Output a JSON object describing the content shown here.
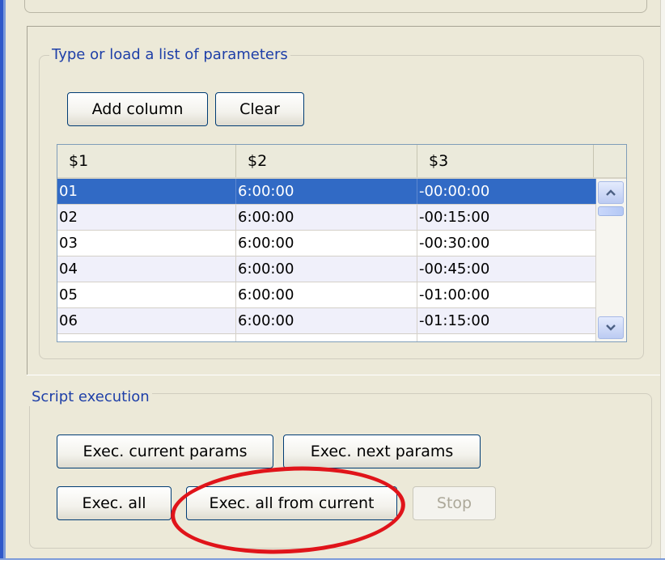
{
  "params_group": {
    "legend": "Type or load a list of parameters",
    "add_column_label": "Add column",
    "clear_label": "Clear"
  },
  "table": {
    "headers": [
      "$1",
      "$2",
      "$3"
    ],
    "rows": [
      [
        "01",
        "6:00:00",
        "-00:00:00"
      ],
      [
        "02",
        "6:00:00",
        "-00:15:00"
      ],
      [
        "03",
        "6:00:00",
        "-00:30:00"
      ],
      [
        "04",
        "6:00:00",
        "-00:45:00"
      ],
      [
        "05",
        "6:00:00",
        "-01:00:00"
      ],
      [
        "06",
        "6:00:00",
        "-01:15:00"
      ]
    ],
    "selected_row": 0
  },
  "script_group": {
    "legend": "Script execution",
    "exec_current_label": "Exec. current params",
    "exec_next_label": "Exec. next params",
    "exec_all_label": "Exec. all",
    "exec_all_from_current_label": "Exec. all from current",
    "stop_label": "Stop"
  },
  "colors": {
    "selection": "#316ac5",
    "highlight_annotation": "#e0141a",
    "button_border": "#003c74",
    "group_legend": "#1e3fa8"
  }
}
